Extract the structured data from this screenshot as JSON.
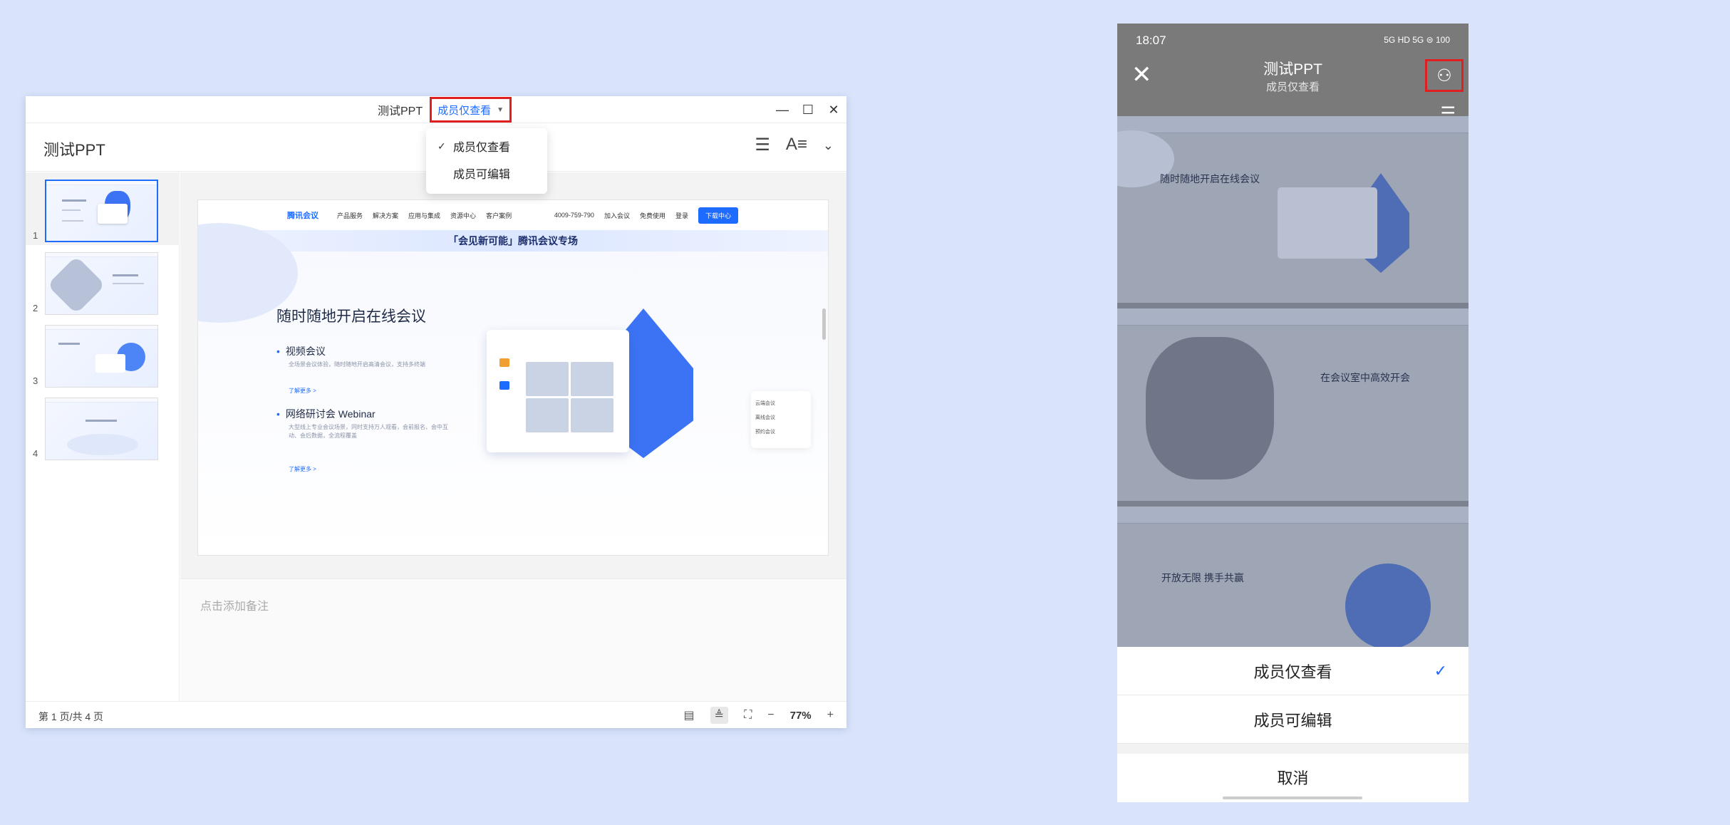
{
  "window": {
    "title": "测试PPT",
    "permission": "成员仅查看",
    "controls": [
      "—",
      "☐",
      "✕"
    ]
  },
  "dropdown": {
    "options": [
      {
        "label": "成员仅查看",
        "selected": true
      },
      {
        "label": "成员可编辑",
        "selected": false
      }
    ]
  },
  "toolbar": {
    "doc_title": "测试PPT"
  },
  "thumbnails": [
    {
      "num": "1"
    },
    {
      "num": "2"
    },
    {
      "num": "3"
    },
    {
      "num": "4"
    }
  ],
  "slide": {
    "logo": "腾讯会议",
    "nav": [
      "产品服务",
      "解决方案",
      "应用与集成",
      "资源中心",
      "客户案例"
    ],
    "phone": "4009-759-790",
    "nav_right": [
      "加入会议",
      "免费使用",
      "登录"
    ],
    "download": "下载中心",
    "banner": "「会见新可能」腾讯会议专场",
    "heading": "随时随地开启在线会议",
    "sub1": "视频会议",
    "text1": "全场景会议体验，随时随地开启高清会议，支持多终端",
    "link1": "了解更多 >",
    "sub2": "网络研讨会 Webinar",
    "text2": "大型线上专业会议场景，同时支持万人观看，会前报名、会中互动、会后数据，全流程覆盖",
    "link2": "了解更多 >",
    "side_items": [
      "云端会议",
      "离线会议",
      "预约会议"
    ]
  },
  "notes": {
    "placeholder": "点击添加备注"
  },
  "status": {
    "page": "第 1 页/共 4 页",
    "zoom": "77%",
    "minus": "−",
    "plus": "+"
  },
  "phone": {
    "time": "18:07",
    "status_icons": "5G HD 5G ⊜ 100",
    "title": "测试PPT",
    "subtitle": "成员仅查看",
    "slides_text": [
      "随时随地开启在线会议",
      "在会议室中高效开会",
      "开放无限 携手共赢"
    ],
    "sheet_options": [
      {
        "label": "成员仅查看",
        "selected": true
      },
      {
        "label": "成员可编辑",
        "selected": false
      }
    ],
    "cancel": "取消"
  }
}
